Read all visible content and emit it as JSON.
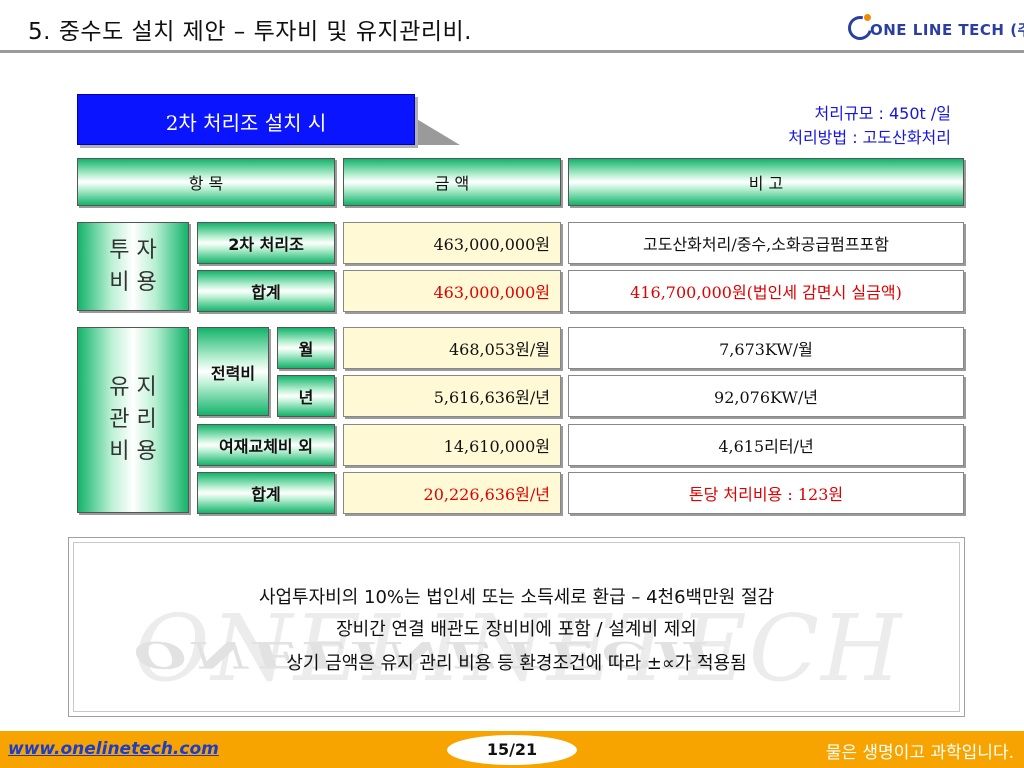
{
  "header": {
    "title": "5. 중수도 설치 제안 – 투자비 및 유지관리비.",
    "logo_text": "ONE LINE TECH (주)"
  },
  "banner": {
    "label": "2차 처리조 설치 시"
  },
  "spec": {
    "capacity": "처리규모 : 450t /일",
    "method": "처리방법 : 고도산화처리"
  },
  "table": {
    "headers": {
      "item": "항   목",
      "amount": "금   액",
      "remark": "비   고"
    },
    "investment": {
      "category": [
        "투 자",
        "비 용"
      ],
      "rows": [
        {
          "label": "2차 처리조",
          "amount": "463,000,000원",
          "remark": "고도산화처리/중수,소화공급펌프포함"
        },
        {
          "label": "합계",
          "amount": "463,000,000원",
          "remark": "416,700,000원(법인세 감면시 실금액)"
        }
      ]
    },
    "maintenance": {
      "category": [
        "유 지",
        "관 리",
        "비 용"
      ],
      "power_label": "전력비",
      "rows": [
        {
          "label": "월",
          "amount": "468,053원/월",
          "remark": "7,673KW/월"
        },
        {
          "label": "년",
          "amount": "5,616,636원/년",
          "remark": "92,076KW/년"
        },
        {
          "label": "여재교체비 외",
          "amount": "14,610,000원",
          "remark": "4,615리터/년"
        },
        {
          "label": "합계",
          "amount": "20,226,636원/년",
          "remark": "톤당 처리비용 : 123원"
        }
      ]
    }
  },
  "notes": {
    "line1": "사업투자비의 10%는 법인세 또는 소득세로 환급 – 4천6백만원 절감",
    "line2": "장비간 연결 배관도 장비비에 포함 / 설계비 제외",
    "line3": "상기 금액은 유지 관리 비용 등 환경조건에 따라 ±∝가 적용됨",
    "watermark": "ONELINETECH"
  },
  "footer": {
    "url": "www.onelinetech.com",
    "page": "15/21",
    "motto": "물은 생명이고 과학입니다."
  },
  "colors": {
    "banner_blue": "#0a14ff",
    "accent_green": "#14b36b",
    "amount_bg": "#fff9d6",
    "highlight_red": "#e00000",
    "spec_blue": "#1616e0",
    "footer_orange": "#f7a400"
  }
}
